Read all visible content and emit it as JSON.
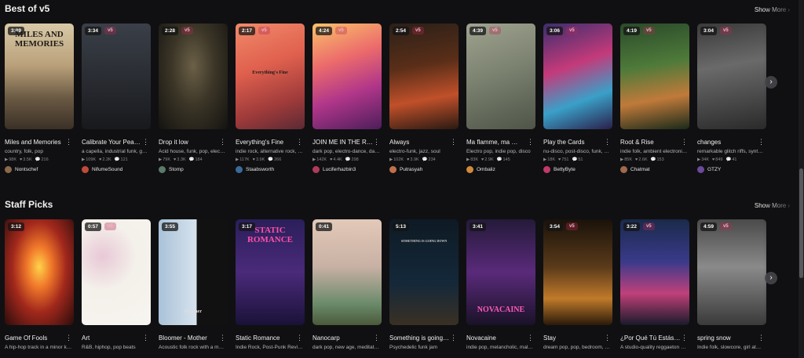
{
  "sections": [
    {
      "title": "Best of v5",
      "show_more": "Show More",
      "cards": [
        {
          "title": "Miles and Memories",
          "tags": "country, folk, pop",
          "plays": "98K",
          "likes": "3.5K",
          "comments": "216",
          "author": "Nontschef",
          "duration": "3:09",
          "version": "",
          "art_text": "MILES AND MEMORIES"
        },
        {
          "title": "Calibrate Your Peac…",
          "tags": "a capella, industrial funk, go…",
          "plays": "109K",
          "likes": "2.2K",
          "comments": "121",
          "author": "NifumeSound",
          "duration": "3:34",
          "version": "v5",
          "art_text": ""
        },
        {
          "title": "Drop it low",
          "tags": "Acid house, funk, pop, elect…",
          "plays": "79K",
          "likes": "3.3K",
          "comments": "184",
          "author": "Stomp",
          "duration": "2:28",
          "version": "v5",
          "art_text": ""
        },
        {
          "title": "Everything's Fine",
          "tags": "indie rock, alternative rock, …",
          "plays": "117K",
          "likes": "3.9K",
          "comments": "266",
          "author": "Staabsworth",
          "duration": "2:17",
          "version": "v5",
          "art_text": "Everything's Fine"
        },
        {
          "title": "JOIN ME IN THE RI…",
          "tags": "dark pop, electro-dance, da…",
          "plays": "142K",
          "likes": "4.4K",
          "comments": "298",
          "author": "Luciferhazbin3",
          "duration": "4:24",
          "version": "v5",
          "art_text": ""
        },
        {
          "title": "Always",
          "tags": "electro-funk, jazz, soul",
          "plays": "102K",
          "likes": "3.9K",
          "comments": "234",
          "author": "Putrasyah",
          "duration": "2:54",
          "version": "v5",
          "art_text": ""
        },
        {
          "title": "Ma flamme, ma …",
          "tags": "Electro pop, indie pop, disco",
          "plays": "83K",
          "likes": "2.9K",
          "comments": "145",
          "author": "Ombaliz",
          "duration": "4:39",
          "version": "v5",
          "art_text": ""
        },
        {
          "title": "Play the Cards",
          "tags": "nu-disco, post-disco, funk, …",
          "plays": "18K",
          "likes": "751",
          "comments": "51",
          "author": "BettyByte",
          "duration": "3:06",
          "version": "v5",
          "art_text": ""
        },
        {
          "title": "Root & Rise",
          "tags": "indie folk, ambient electroni…",
          "plays": "85K",
          "likes": "2.6K",
          "comments": "153",
          "author": "Chatmat",
          "duration": "4:19",
          "version": "v5",
          "art_text": ""
        },
        {
          "title": "changes",
          "tags": "remarkable glitch riffs, synth…",
          "plays": "34K",
          "likes": "849",
          "comments": "41",
          "author": "GTZY",
          "duration": "3:04",
          "version": "v5",
          "art_text": ""
        }
      ]
    },
    {
      "title": "Staff Picks",
      "show_more": "Show More",
      "cards": [
        {
          "title": "Game Of Fools",
          "tags": "A hip-hop track in a minor k…",
          "duration": "3:12",
          "version": "",
          "art_text": ""
        },
        {
          "title": "Art",
          "tags": "R&B, hiphop, pop beats",
          "duration": "0:57",
          "version": "v5",
          "art_text": ""
        },
        {
          "title": "Bloomer - Mother",
          "tags": "Acoustic folk rock with a m…",
          "duration": "3:55",
          "version": "",
          "art_text": "Bloomer"
        },
        {
          "title": "Static Romance",
          "tags": "Indie Rock, Post-Punk Revi…",
          "duration": "3:17",
          "version": "",
          "art_text": "STATIC ROMANCE"
        },
        {
          "title": "Nanocarp",
          "tags": "dark pop, new age, meditative",
          "duration": "0:41",
          "version": "",
          "art_text": ""
        },
        {
          "title": "Something is going …",
          "tags": "Psychedelic funk jam",
          "duration": "5:13",
          "version": "",
          "art_text": "SOMETHING IS GOING DOWN"
        },
        {
          "title": "Novacaine",
          "tags": "indie pop, melancholic, mal…",
          "duration": "3:41",
          "version": "",
          "art_text": "NOVACAINE"
        },
        {
          "title": "Stay",
          "tags": "dream pop, pop, bedroom, …",
          "duration": "3:54",
          "version": "v5",
          "art_text": ""
        },
        {
          "title": "¿Por Qué Tú Estás …",
          "tags": "A studio-quality reggaeton …",
          "duration": "3:22",
          "version": "v5",
          "art_text": ""
        },
        {
          "title": "spring snow",
          "tags": "Indie folk, slowcore, girl at…",
          "duration": "4:59",
          "version": "v5",
          "art_text": ""
        }
      ]
    }
  ],
  "icons": {
    "play_stat": "▶",
    "like_stat": "♥",
    "comment_stat": "💬",
    "chevron": "›",
    "kebab": "⋮"
  }
}
